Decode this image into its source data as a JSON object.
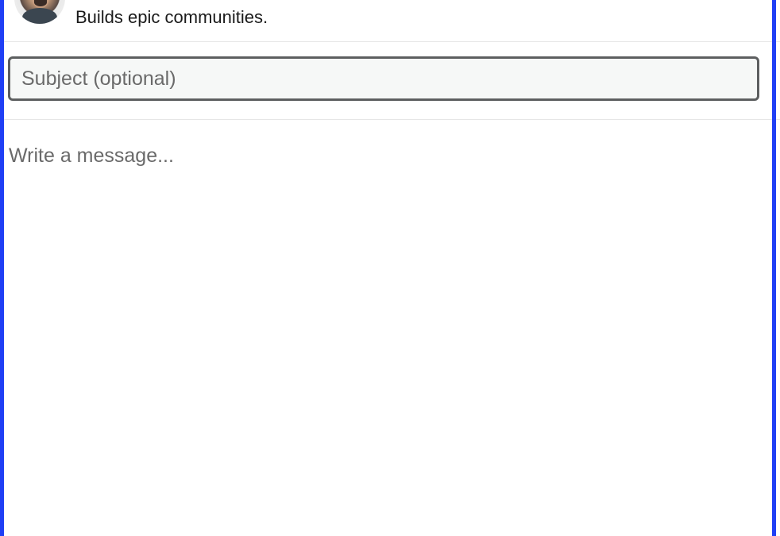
{
  "profile": {
    "tagline": "Builds epic communities."
  },
  "compose": {
    "subject_placeholder": "Subject (optional)",
    "message_placeholder": "Write a message..."
  },
  "colors": {
    "accent_border": "#1f3ff5",
    "input_border": "#5d5f60",
    "input_background": "#f6f8f7",
    "placeholder_text": "#6a6a6a"
  }
}
